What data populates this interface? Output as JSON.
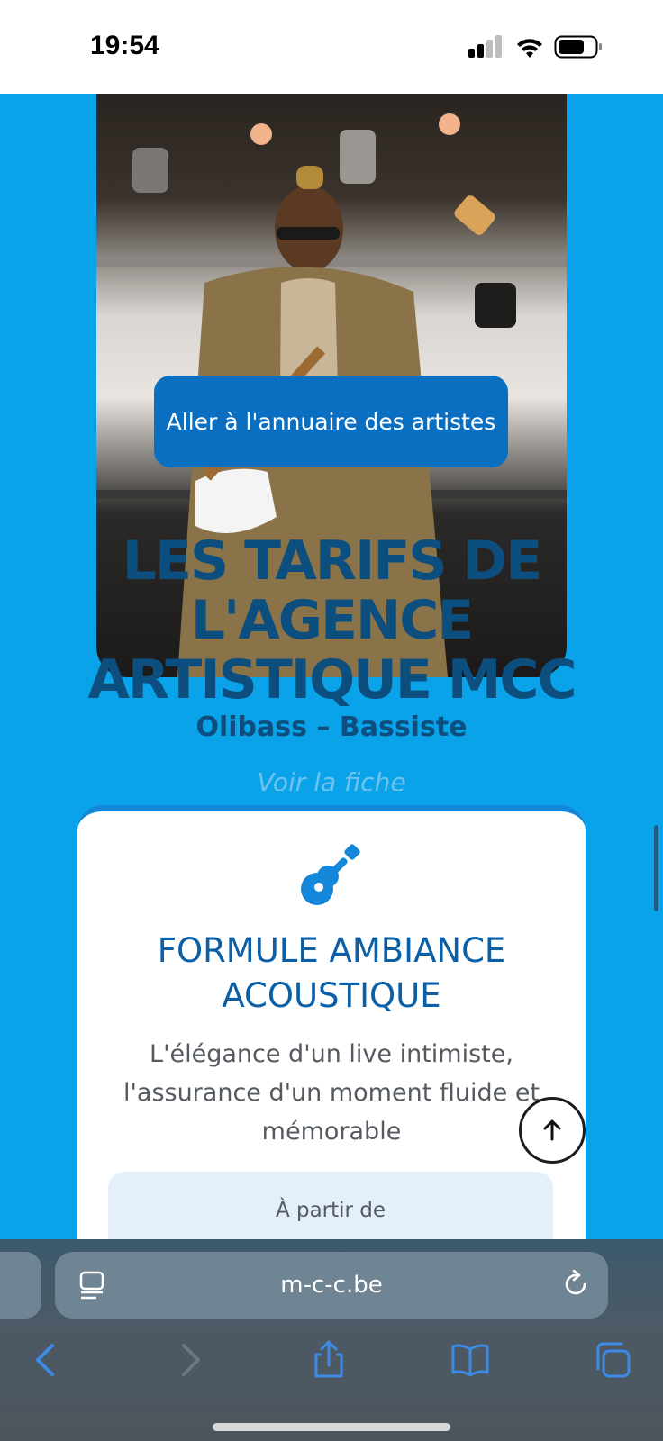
{
  "status_bar": {
    "time": "19:54"
  },
  "hero": {
    "directory_button_label": "Aller à l'annuaire des artistes",
    "title": "LES TARIFS DE L'AGENCE ARTISTIQUE MCC",
    "artist_caption": "Olibass – Bassiste",
    "view_sheet_link": "Voir la fiche"
  },
  "pricing_card": {
    "icon": "guitar-icon",
    "title": "FORMULE AMBIANCE ACOUSTIQUE",
    "description": "L'élégance d'un live intimiste, l'assurance d'un moment fluide et mémorable",
    "price_label": "À partir de"
  },
  "browser": {
    "url": "m-c-c.be",
    "accent": "#3d8be6"
  },
  "colors": {
    "page_background": "#0aa3e9",
    "title_color": "#0c4f7e",
    "button_color": "#0a6fc0"
  }
}
